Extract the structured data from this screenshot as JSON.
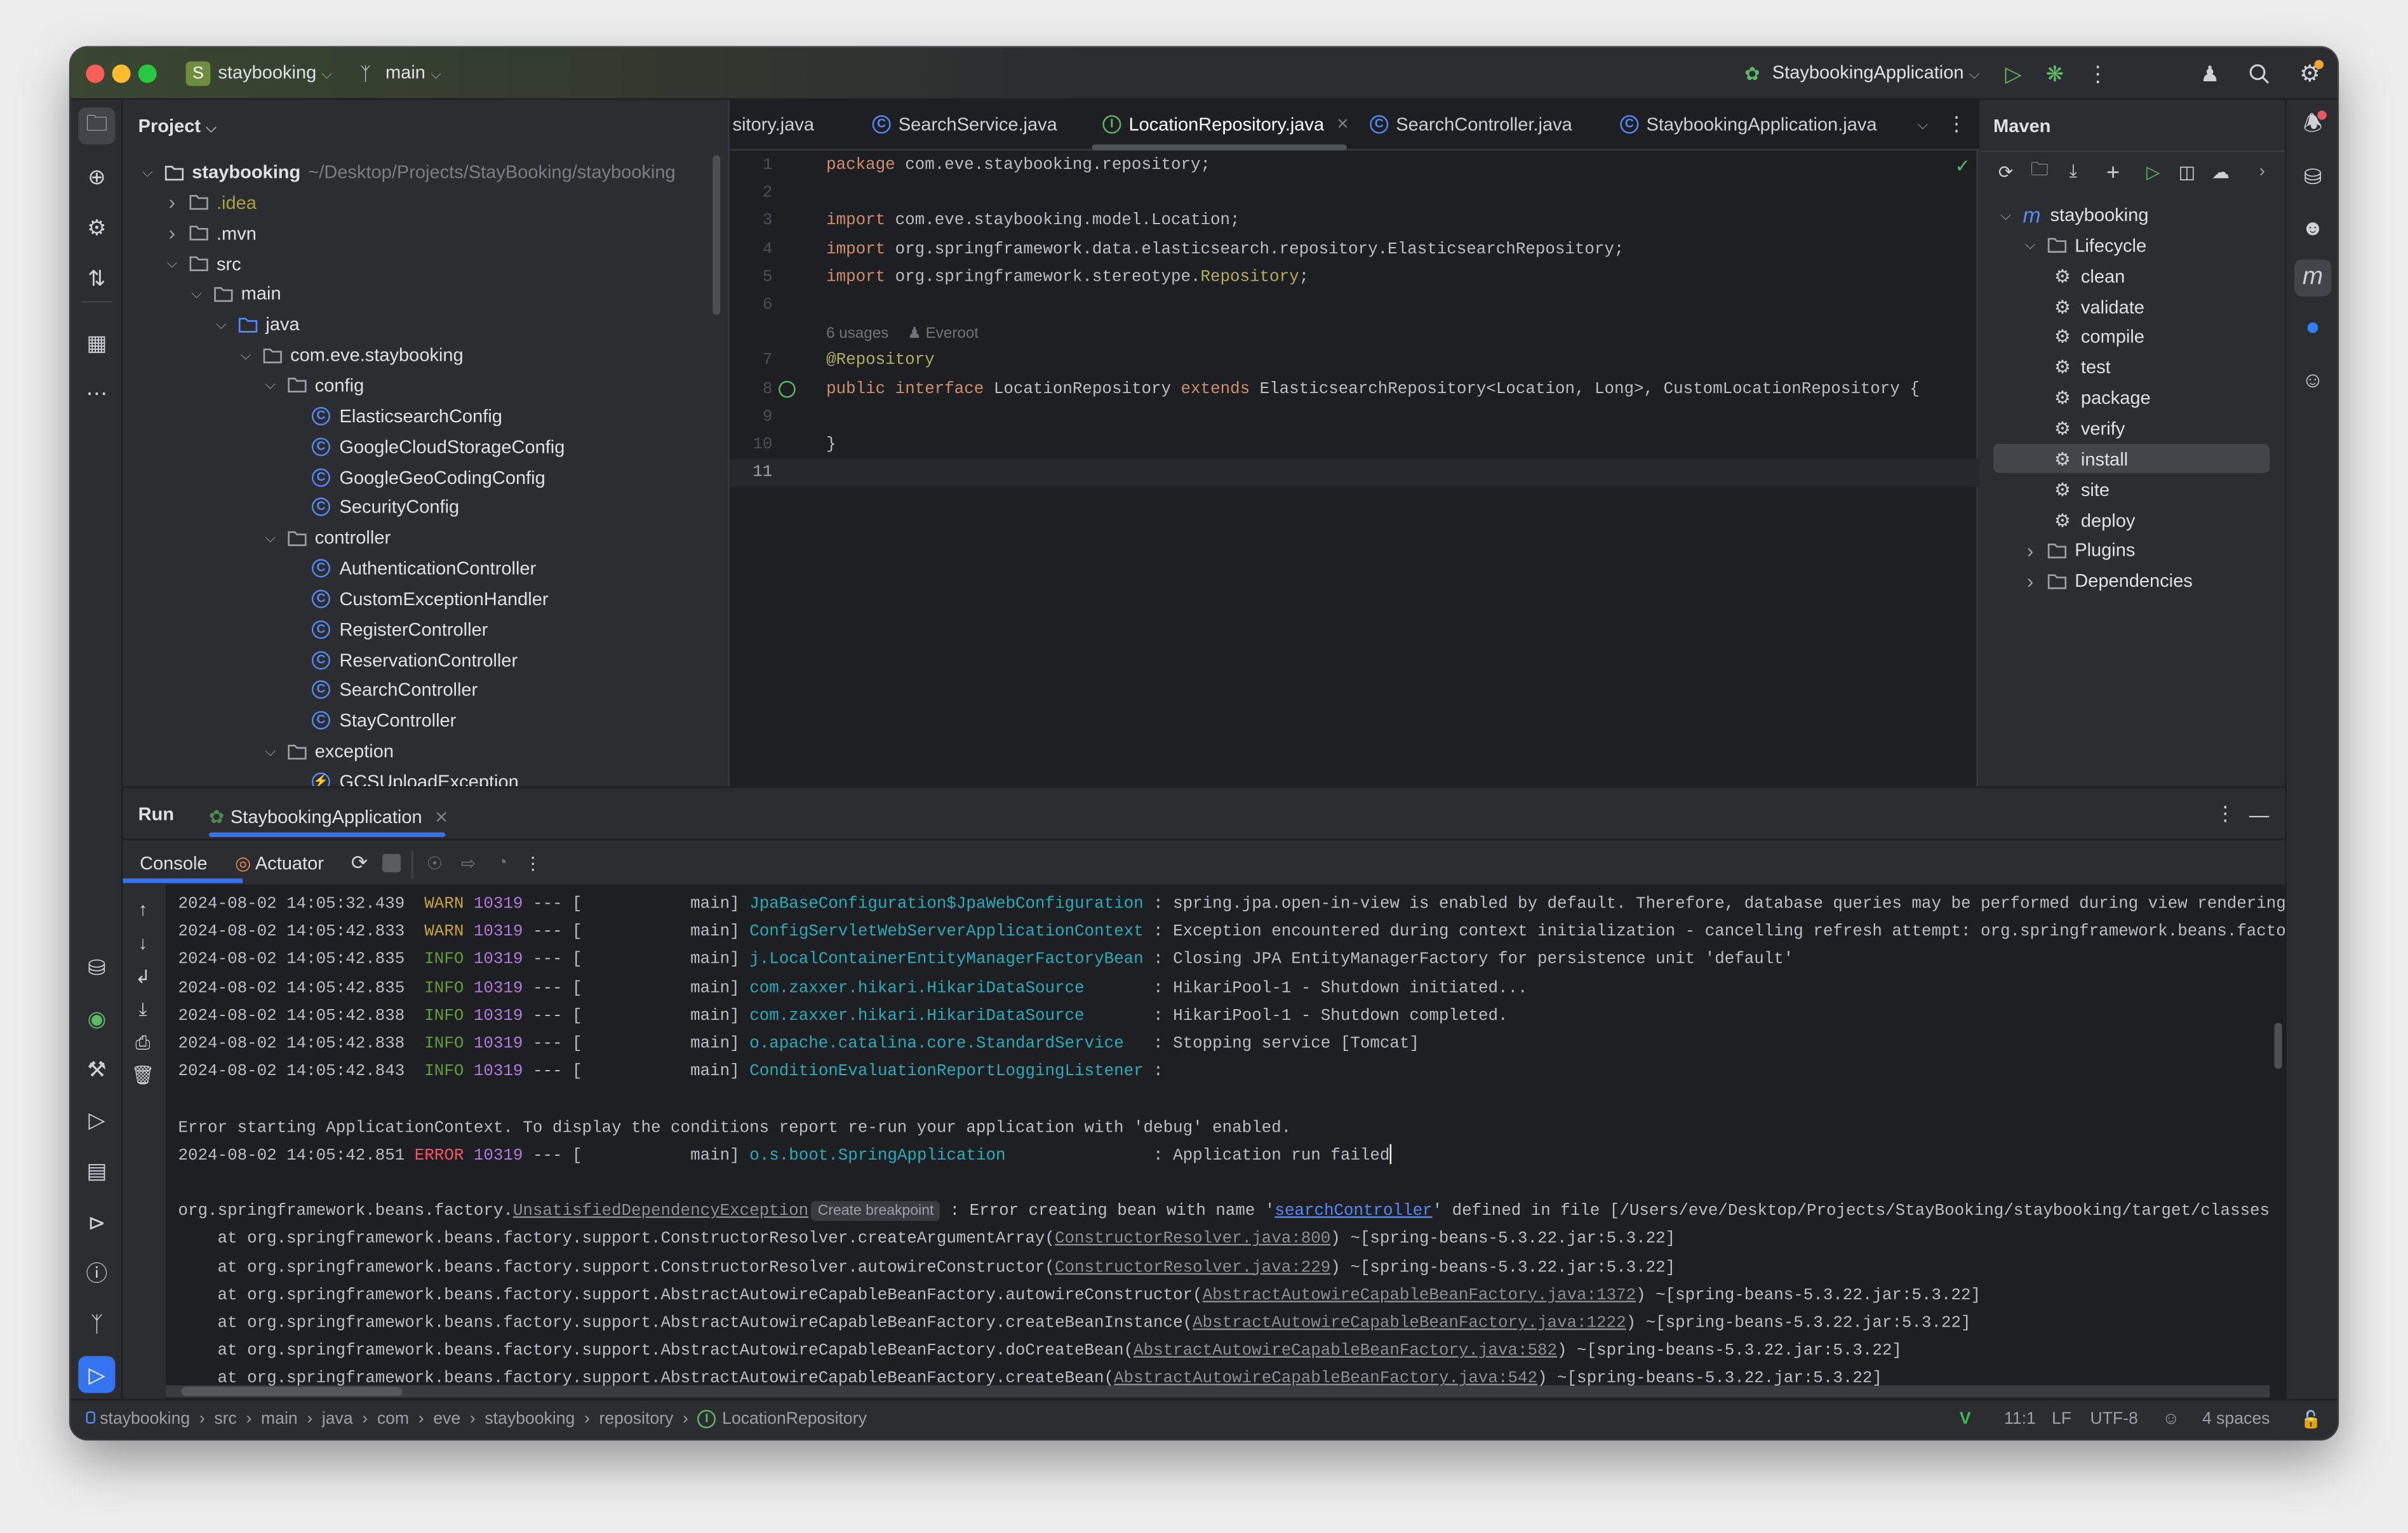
{
  "title_bar": {
    "project_badge": "S",
    "project": "staybooking",
    "branch": "main",
    "run_config": "StaybookingApplication",
    "colors": {
      "badge": "#6f8d3e",
      "close": "#ff5f57",
      "minimize": "#febc2e",
      "zoom": "#28c840",
      "run": "#5fb865"
    }
  },
  "project_panel": {
    "title": "Project",
    "tree": [
      {
        "label": "staybooking",
        "path": "~/Desktop/Projects/StayBooking/staybooking",
        "level": 0,
        "state": "expanded",
        "icon": "module-folder-icon",
        "bold": true
      },
      {
        "label": ".idea",
        "level": 1,
        "state": "collapsed",
        "icon": "folder-icon",
        "color": "#a8a33a"
      },
      {
        "label": ".mvn",
        "level": 1,
        "state": "collapsed",
        "icon": "folder-icon"
      },
      {
        "label": "src",
        "level": 1,
        "state": "expanded",
        "icon": "folder-icon"
      },
      {
        "label": "main",
        "level": 2,
        "state": "expanded",
        "icon": "folder-icon"
      },
      {
        "label": "java",
        "level": 3,
        "state": "expanded",
        "icon": "source-folder-icon"
      },
      {
        "label": "com.eve.staybooking",
        "level": 4,
        "state": "expanded",
        "icon": "package-icon"
      },
      {
        "label": "config",
        "level": 5,
        "state": "expanded",
        "icon": "package-icon"
      },
      {
        "label": "ElasticsearchConfig",
        "level": 6,
        "icon": "class-icon"
      },
      {
        "label": "GoogleCloudStorageConfig",
        "level": 6,
        "icon": "class-icon"
      },
      {
        "label": "GoogleGeoCodingConfig",
        "level": 6,
        "icon": "class-icon"
      },
      {
        "label": "SecurityConfig",
        "level": 6,
        "icon": "class-icon"
      },
      {
        "label": "controller",
        "level": 5,
        "state": "expanded",
        "icon": "package-icon"
      },
      {
        "label": "AuthenticationController",
        "level": 6,
        "icon": "class-icon"
      },
      {
        "label": "CustomExceptionHandler",
        "level": 6,
        "icon": "class-icon"
      },
      {
        "label": "RegisterController",
        "level": 6,
        "icon": "class-icon"
      },
      {
        "label": "ReservationController",
        "level": 6,
        "icon": "class-icon"
      },
      {
        "label": "SearchController",
        "level": 6,
        "icon": "class-icon"
      },
      {
        "label": "StayController",
        "level": 6,
        "icon": "class-icon"
      },
      {
        "label": "exception",
        "level": 5,
        "state": "expanded",
        "icon": "package-icon"
      },
      {
        "label": "GCSUploadException",
        "level": 6,
        "icon": "exception-class-icon"
      }
    ]
  },
  "editor": {
    "tabs": [
      {
        "label": "sitory.java",
        "icon": "none"
      },
      {
        "label": "SearchService.java",
        "icon": "class-icon"
      },
      {
        "label": "LocationRepository.java",
        "icon": "interface-icon",
        "active": true,
        "closable": true
      },
      {
        "label": "SearchController.java",
        "icon": "class-icon"
      },
      {
        "label": "StaybookingApplication.java",
        "icon": "spring-class-icon"
      }
    ],
    "inlay_hint": {
      "usages": "6 usages",
      "author": "Everoot"
    },
    "inspection_status": "ok",
    "lines": [
      {
        "n": "1",
        "tokens": [
          {
            "t": "package",
            "c": "kw"
          },
          {
            "t": " com.eve.staybooking.repository;",
            "c": "tx"
          }
        ]
      },
      {
        "n": "2",
        "tokens": []
      },
      {
        "n": "3",
        "tokens": [
          {
            "t": "import",
            "c": "kw"
          },
          {
            "t": " com.eve.staybooking.model.Location;",
            "c": "tx"
          }
        ]
      },
      {
        "n": "4",
        "tokens": [
          {
            "t": "import",
            "c": "kw"
          },
          {
            "t": " org.springframework.data.elasticsearch.repository.ElasticsearchRepository;",
            "c": "tx"
          }
        ]
      },
      {
        "n": "5",
        "tokens": [
          {
            "t": "import",
            "c": "kw"
          },
          {
            "t": " org.springframework.stereotype.",
            "c": "tx"
          },
          {
            "t": "Repository",
            "c": "an"
          },
          {
            "t": ";",
            "c": "tx"
          }
        ]
      },
      {
        "n": "6",
        "tokens": []
      },
      {
        "hint": true
      },
      {
        "n": "7",
        "tokens": [
          {
            "t": "@Repository",
            "c": "an"
          }
        ]
      },
      {
        "n": "8",
        "gutter": "implemented-icon",
        "tokens": [
          {
            "t": "public",
            "c": "kw"
          },
          {
            "t": " ",
            "c": "tx"
          },
          {
            "t": "interface",
            "c": "kw"
          },
          {
            "t": " LocationRepository ",
            "c": "tx"
          },
          {
            "t": "extends",
            "c": "kw"
          },
          {
            "t": " ElasticsearchRepository<Location, Long>, CustomLocationRepository {",
            "c": "tx"
          }
        ]
      },
      {
        "n": "9",
        "tokens": []
      },
      {
        "n": "10",
        "tokens": [
          {
            "t": "}",
            "c": "tx"
          }
        ]
      },
      {
        "n": "11",
        "tokens": [],
        "current": true
      }
    ]
  },
  "maven": {
    "title": "Maven",
    "tree": [
      {
        "label": "staybooking",
        "level": 0,
        "state": "expanded",
        "icon": "maven-icon"
      },
      {
        "label": "Lifecycle",
        "level": 1,
        "state": "expanded",
        "icon": "lifecycle-folder-icon"
      },
      {
        "label": "clean",
        "level": 2,
        "icon": "gear-icon"
      },
      {
        "label": "validate",
        "level": 2,
        "icon": "gear-icon"
      },
      {
        "label": "compile",
        "level": 2,
        "icon": "gear-icon"
      },
      {
        "label": "test",
        "level": 2,
        "icon": "gear-icon"
      },
      {
        "label": "package",
        "level": 2,
        "icon": "gear-icon"
      },
      {
        "label": "verify",
        "level": 2,
        "icon": "gear-icon"
      },
      {
        "label": "install",
        "level": 2,
        "icon": "gear-icon",
        "selected": true
      },
      {
        "label": "site",
        "level": 2,
        "icon": "gear-icon"
      },
      {
        "label": "deploy",
        "level": 2,
        "icon": "gear-icon"
      },
      {
        "label": "Plugins",
        "level": 1,
        "state": "collapsed",
        "icon": "plugins-folder-icon"
      },
      {
        "label": "Dependencies",
        "level": 1,
        "state": "collapsed",
        "icon": "dependencies-folder-icon"
      }
    ]
  },
  "run_panel": {
    "title": "Run",
    "tab": "StaybookingApplication",
    "sub_tabs": {
      "console": "Console",
      "actuator": "Actuator"
    },
    "format": {
      "sep": " --- [",
      "thread_close": "] ",
      "colon": " : ",
      "at": "at ",
      "open": "(",
      "close": ") "
    },
    "logs": [
      {
        "timestamp": "2024-08-02 14:05:32.439",
        "level": "WARN",
        "pid": "10319",
        "thread": "main",
        "logger": "JpaBaseConfiguration$JpaWebConfiguration",
        "message": "spring.jpa.open-in-view is enabled by default. Therefore, database queries may be performed during view rendering"
      },
      {
        "timestamp": "2024-08-02 14:05:42.833",
        "level": "WARN",
        "pid": "10319",
        "thread": "main",
        "logger": "ConfigServletWebServerApplicationContext",
        "message": "Exception encountered during context initialization - cancelling refresh attempt: org.springframework.beans.factory"
      },
      {
        "timestamp": "2024-08-02 14:05:42.835",
        "level": "INFO",
        "pid": "10319",
        "thread": "main",
        "logger": "j.LocalContainerEntityManagerFactoryBean",
        "message": "Closing JPA EntityManagerFactory for persistence unit 'default'"
      },
      {
        "timestamp": "2024-08-02 14:05:42.835",
        "level": "INFO",
        "pid": "10319",
        "thread": "main",
        "logger": "com.zaxxer.hikari.HikariDataSource",
        "message": "HikariPool-1 - Shutdown initiated..."
      },
      {
        "timestamp": "2024-08-02 14:05:42.838",
        "level": "INFO",
        "pid": "10319",
        "thread": "main",
        "logger": "com.zaxxer.hikari.HikariDataSource",
        "message": "HikariPool-1 - Shutdown completed."
      },
      {
        "timestamp": "2024-08-02 14:05:42.838",
        "level": "INFO",
        "pid": "10319",
        "thread": "main",
        "logger": "o.apache.catalina.core.StandardService",
        "message": "Stopping service [Tomcat]"
      },
      {
        "timestamp": "2024-08-02 14:05:42.843",
        "level": "INFO",
        "pid": "10319",
        "thread": "main",
        "logger": "ConditionEvaluationReportLoggingListener",
        "message": ""
      }
    ],
    "error_notice": "Error starting ApplicationContext. To display the conditions report re-run your application with 'debug' enabled.",
    "error_log": {
      "timestamp": "2024-08-02 14:05:42.851",
      "level": "ERROR",
      "pid": "10319",
      "thread": "main",
      "logger": "o.s.boot.SpringApplication",
      "message": "Application run failed"
    },
    "exception": {
      "package": "org.springframework.beans.factory.",
      "class_link": "UnsatisfiedDependencyException",
      "breakpoint_badge": "Create breakpoint",
      "msg_before": " : Error creating bean with name '",
      "bean_link": "searchController",
      "msg_after": "' defined in file [/Users/eve/Desktop/Projects/StayBooking/staybooking/target/classes"
    },
    "frames": [
      {
        "method": "org.springframework.beans.factory.support.ConstructorResolver.createArgumentArray",
        "source": "ConstructorResolver.java:800",
        "jar": "~[spring-beans-5.3.22.jar:5.3.22]"
      },
      {
        "method": "org.springframework.beans.factory.support.ConstructorResolver.autowireConstructor",
        "source": "ConstructorResolver.java:229",
        "jar": "~[spring-beans-5.3.22.jar:5.3.22]"
      },
      {
        "method": "org.springframework.beans.factory.support.AbstractAutowireCapableBeanFactory.autowireConstructor",
        "source": "AbstractAutowireCapableBeanFactory.java:1372",
        "jar": "~[spring-beans-5.3.22.jar:5.3.22]"
      },
      {
        "method": "org.springframework.beans.factory.support.AbstractAutowireCapableBeanFactory.createBeanInstance",
        "source": "AbstractAutowireCapableBeanFactory.java:1222",
        "jar": "~[spring-beans-5.3.22.jar:5.3.22]"
      },
      {
        "method": "org.springframework.beans.factory.support.AbstractAutowireCapableBeanFactory.doCreateBean",
        "source": "AbstractAutowireCapableBeanFactory.java:582",
        "jar": "~[spring-beans-5.3.22.jar:5.3.22]"
      },
      {
        "method": "org.springframework.beans.factory.support.AbstractAutowireCapableBeanFactory.createBean",
        "source": "AbstractAutowireCapableBeanFactory.java:542",
        "jar": "~[spring-beans-5.3.22.jar:5.3.22]"
      }
    ]
  },
  "status_bar": {
    "breadcrumbs": [
      "staybooking",
      "src",
      "main",
      "java",
      "com",
      "eve",
      "staybooking",
      "repository",
      "LocationRepository"
    ],
    "position": "11:1",
    "line_separator": "LF",
    "encoding": "UTF-8",
    "indent": "4 spaces"
  }
}
